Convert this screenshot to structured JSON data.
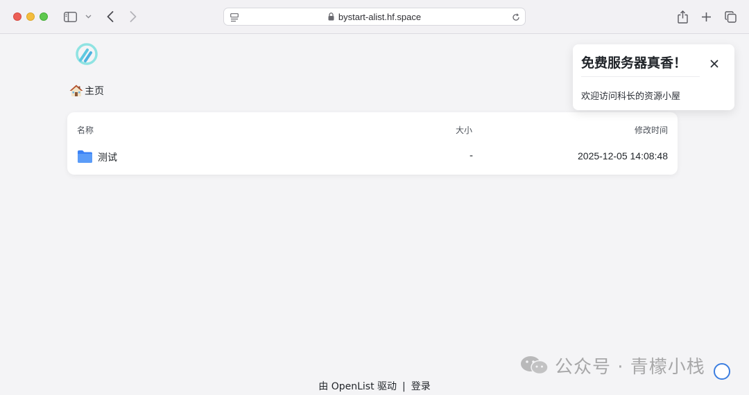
{
  "browser": {
    "url": "bystart-alist.hf.space"
  },
  "breadcrumb": {
    "home_label": "主页"
  },
  "file_list": {
    "columns": {
      "name": "名称",
      "size": "大小",
      "modified": "修改时间"
    },
    "rows": [
      {
        "name": "测试",
        "size": "-",
        "modified": "2025-12-05 14:08:48",
        "type": "folder"
      }
    ]
  },
  "notice": {
    "title": "免费服务器真香！",
    "body": "欢迎访问科长的资源小屋"
  },
  "footer": {
    "powered_by": "由 OpenList 驱动",
    "separator": "|",
    "login": "登录"
  },
  "watermark": {
    "text": "公众号 · 青檬小栈"
  },
  "colors": {
    "accent": "#3a7de0",
    "folder": "#3b82f6",
    "logo": "#5fd3d6"
  }
}
